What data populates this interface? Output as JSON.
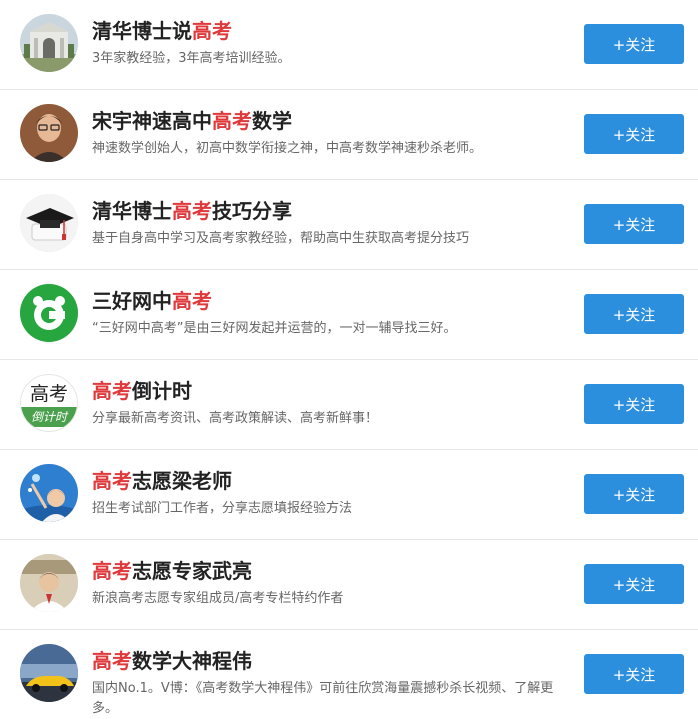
{
  "follow_label": "+关注",
  "accent_color": "#e0393b",
  "button_color": "#2b8fdd",
  "accounts": [
    {
      "title_pre": "清华博士说",
      "title_hl": "高考",
      "title_post": "",
      "desc": "3年家教经验，3年高考培训经验。",
      "avatar_icon": "university-gate-icon"
    },
    {
      "title_pre": "宋宇神速高中",
      "title_hl": "高考",
      "title_post": "数学",
      "desc": "神速数学创始人，初高中数学衔接之神，中高考数学神速秒杀老师。",
      "avatar_icon": "person-portrait-icon"
    },
    {
      "title_pre": "清华博士",
      "title_hl": "高考",
      "title_post": "技巧分享",
      "desc": "基于自身高中学习及高考家教经验，帮助高中生获取高考提分技巧",
      "avatar_icon": "graduation-cap-icon"
    },
    {
      "title_pre": "三好网中",
      "title_hl": "高考",
      "title_post": "",
      "desc": "“三好网中高考”是由三好网发起并运营的，一对一辅导找三好。",
      "avatar_icon": "sanhao-logo-icon"
    },
    {
      "title_pre": "",
      "title_hl": "高考",
      "title_post": "倒计时",
      "desc": "分享最新高考资讯、高考政策解读、高考新鲜事！",
      "avatar_icon": "countdown-text-icon",
      "avatar_text_top": "高考",
      "avatar_text_bottom": "倒计时"
    },
    {
      "title_pre": "",
      "title_hl": "高考",
      "title_post": "志愿梁老师",
      "desc": "招生考试部门工作者，分享志愿填报经验方法",
      "avatar_icon": "person-blue-sky-icon"
    },
    {
      "title_pre": "",
      "title_hl": "高考",
      "title_post": "志愿专家武亮",
      "desc": "新浪高考志愿专家组成员/高考专栏特约作者",
      "avatar_icon": "person-portrait-icon"
    },
    {
      "title_pre": "",
      "title_hl": "高考",
      "title_post": "数学大神程伟",
      "desc": "国内No.1。V博：《高考数学大神程伟》可前往欣赏海量震撼秒杀长视频、了解更多。",
      "avatar_icon": "sports-car-icon"
    }
  ]
}
